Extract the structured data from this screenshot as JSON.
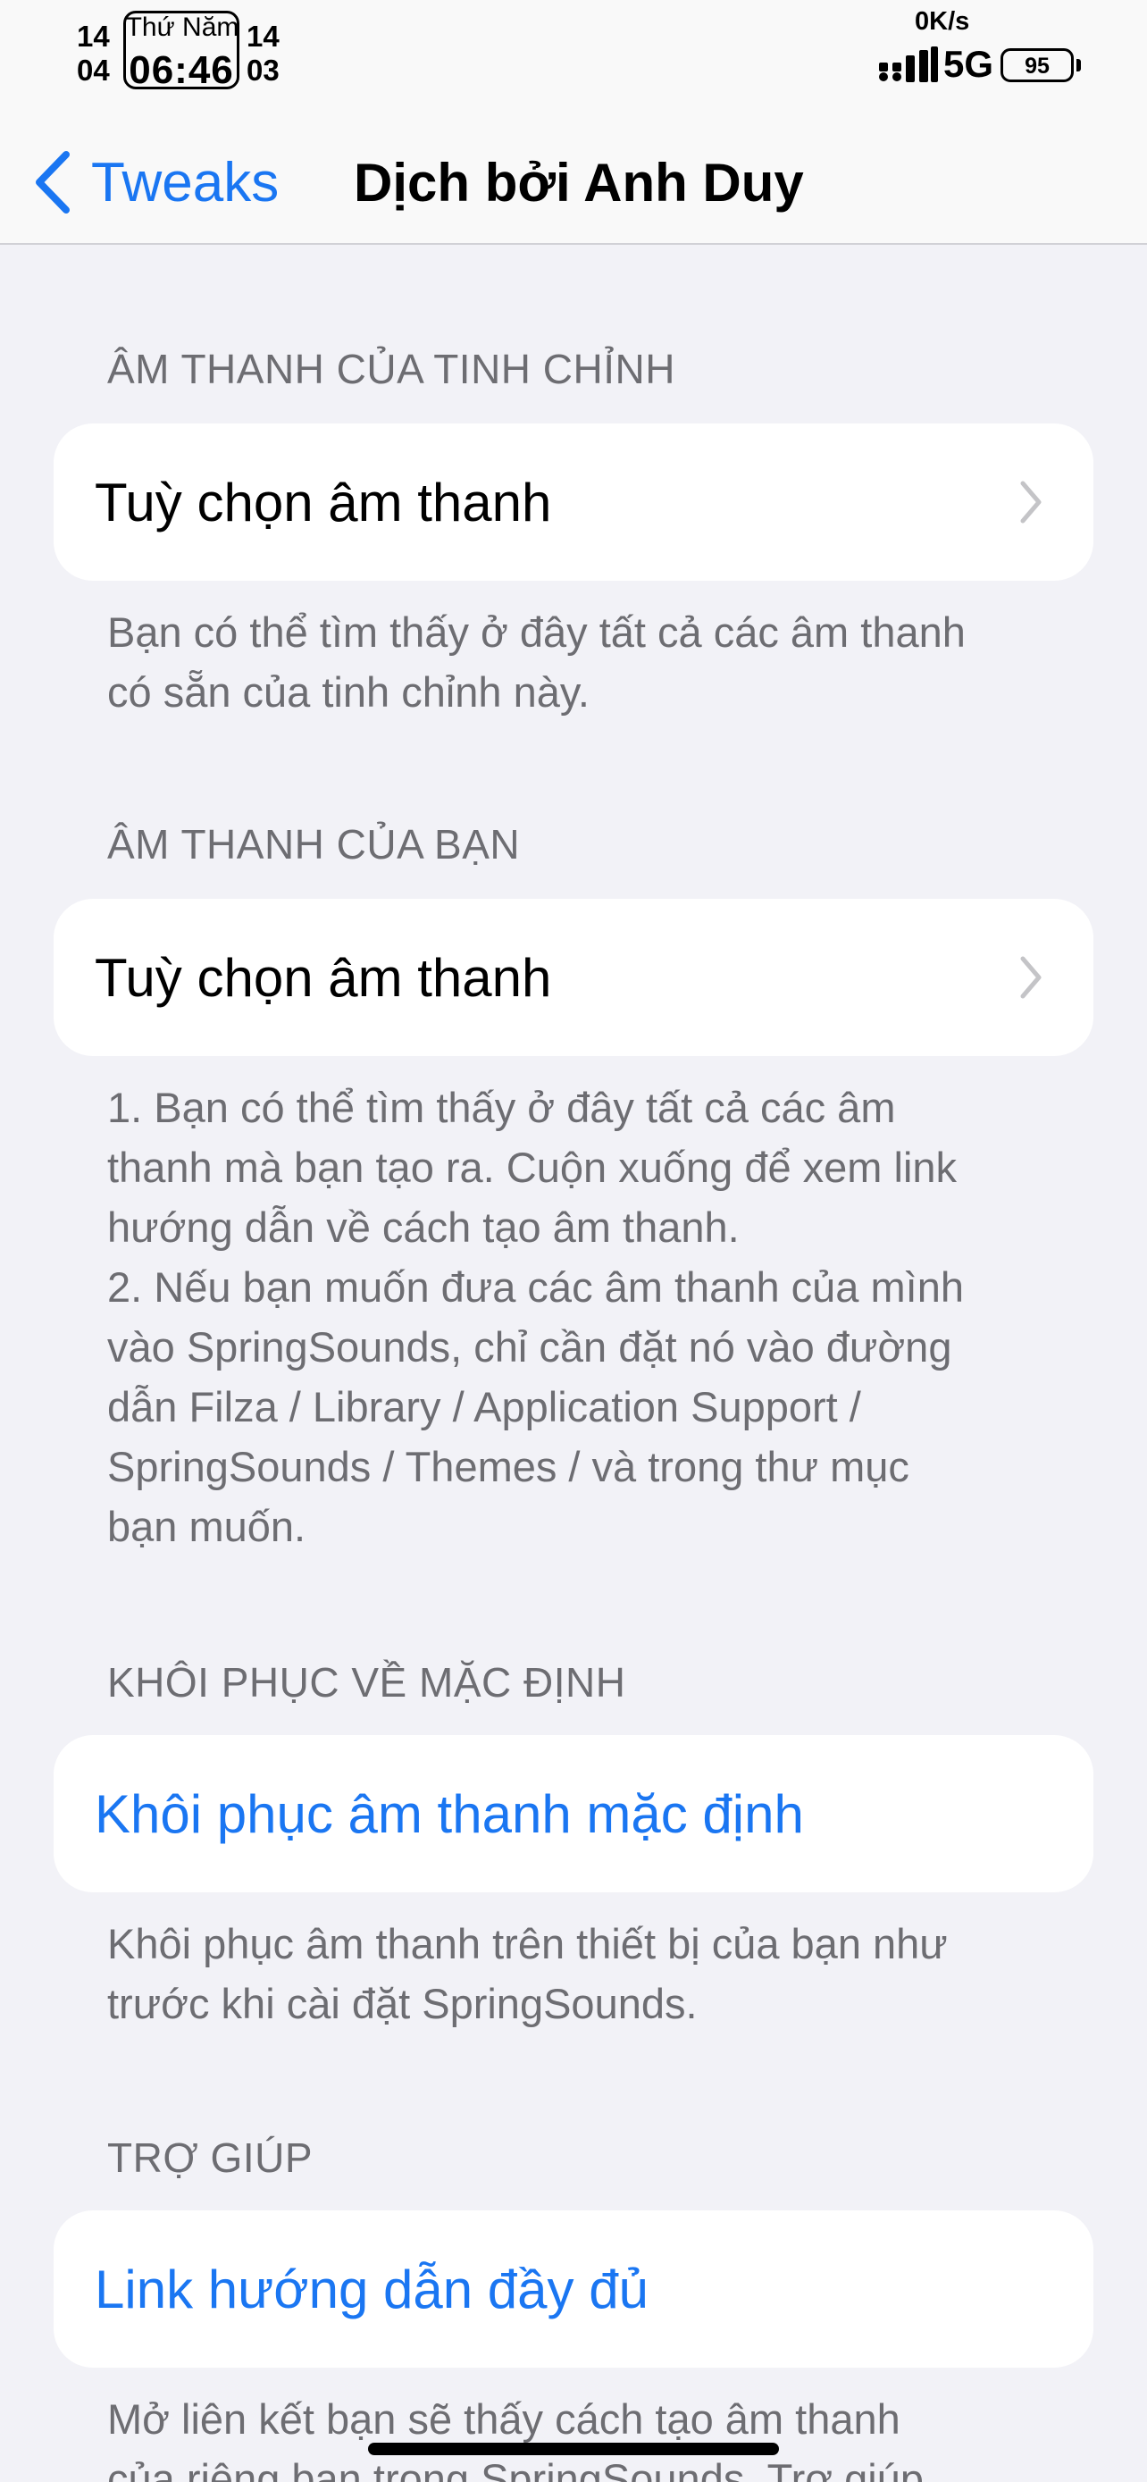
{
  "status_bar": {
    "left_top": "14",
    "left_bottom": "04",
    "day": "Thứ Năm",
    "time": "06:46",
    "right_top": "14",
    "right_bottom": "03",
    "net_speed": "0K/s",
    "network": "5G",
    "battery": "95"
  },
  "nav": {
    "back_label": "Tweaks",
    "title": "Dịch bởi Anh Duy"
  },
  "sections": [
    {
      "header": "ÂM THANH CỦA TINH CHỈNH",
      "row_label": "Tuỳ chọn âm thanh",
      "footer": [
        "Bạn có thể tìm thấy ở đây tất cả các âm thanh",
        "có sẵn của tinh chỉnh này."
      ]
    },
    {
      "header": "ÂM THANH CỦA BẠN",
      "row_label": "Tuỳ chọn âm thanh",
      "footer": [
        "1. Bạn có thể tìm thấy ở đây tất cả các âm",
        "thanh mà bạn tạo ra. Cuộn xuống để xem link",
        "hướng dẫn về cách tạo âm thanh.",
        "2. Nếu bạn muốn đưa các âm thanh của mình",
        "vào SpringSounds, chỉ cần đặt nó vào đường",
        "dẫn Filza / Library / Application Support /",
        "SpringSounds / Themes / và trong thư mục",
        "bạn muốn."
      ]
    },
    {
      "header": "KHÔI PHỤC VỀ MẶC ĐỊNH",
      "row_label": "Khôi phục âm thanh mặc định",
      "footer": [
        "Khôi phục âm thanh trên thiết bị của bạn như",
        "trước khi cài đặt SpringSounds."
      ]
    },
    {
      "header": "TRỢ GIÚP",
      "row_label": "Link hướng dẫn đầy đủ",
      "footer": [
        "Mở liên kết bạn sẽ thấy cách tạo âm thanh",
        "của riêng bạn trong SpringSounds. Trợ giúp"
      ]
    }
  ],
  "colors": {
    "accent": "#1a76f2",
    "background": "#f2f2f7",
    "secondary_text": "#6d6d72"
  }
}
